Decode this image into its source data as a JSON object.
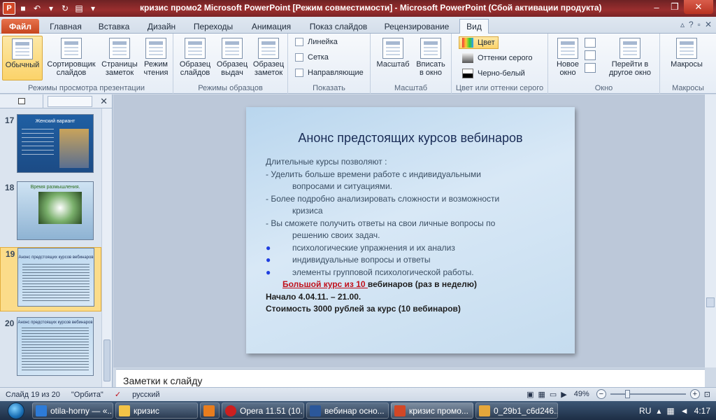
{
  "window": {
    "title": "кризис промо2 Microsoft PowerPoint [Режим совместимости]  -  Microsoft PowerPoint (Сбой активации продукта)"
  },
  "tabs": [
    "Файл",
    "Главная",
    "Вставка",
    "Дизайн",
    "Переходы",
    "Анимация",
    "Показ слайдов",
    "Рецензирование",
    "Вид"
  ],
  "ribbon": {
    "groups": {
      "presentation_views": "Режимы просмотра презентации",
      "master_views": "Режимы образцов",
      "show": "Показать",
      "zoom": "Масштаб",
      "color": "Цвет или оттенки серого",
      "window": "Окно",
      "macros": "Макросы"
    },
    "buttons": {
      "normal": "Обычный",
      "sorter_1": "Сортировщик",
      "sorter_2": "слайдов",
      "notes_1": "Страницы",
      "notes_2": "заметок",
      "reading_1": "Режим",
      "reading_2": "чтения",
      "slide_master_1": "Образец",
      "slide_master_2": "слайдов",
      "handout_master_1": "Образец",
      "handout_master_2": "выдач",
      "notes_master_1": "Образец",
      "notes_master_2": "заметок",
      "zoom": "Масштаб",
      "fit_1": "Вписать",
      "fit_2": "в окно",
      "new_window_1": "Новое",
      "new_window_2": "окно",
      "switch_1": "Перейти в",
      "switch_2": "другое окно",
      "macros": "Макросы"
    },
    "show": {
      "ruler": "Линейка",
      "grid": "Сетка",
      "guides": "Направляющие"
    },
    "color": {
      "color": "Цвет",
      "grayscale": "Оттенки серого",
      "bw": "Черно-белый"
    }
  },
  "slides_panel": {
    "items": [
      {
        "num": "17",
        "title": "Женский вариант"
      },
      {
        "num": "18",
        "title": "Время размышления."
      },
      {
        "num": "19",
        "title": "Анонс предстоящих курсов вебинаров"
      },
      {
        "num": "20",
        "title": "Анонс предстоящих курсов вебинаров"
      }
    ]
  },
  "slide": {
    "title": "Анонс предстоящих  курсов вебинаров",
    "intro": "Длительные  курсы позволяют :",
    "p1a": " - Уделить больше времени   работе   с индивидуальными",
    "p1b": "вопросами и ситуациями.",
    "p2a": "- Более подробно анализировать   сложности и возможности",
    "p2b": "кризиса",
    "p3a": "- Вы сможете получить ответы  на свои личные  вопросы по",
    "p3b": "решению  своих задач.",
    "b1": "психологические  упражнения и их анализ",
    "b2": "индивидуальные вопросы  и ответы",
    "b3": "элементы   групповой психологической работы.",
    "big_red": "Большой курс из 10 ",
    "big_rest": "вебинаров (раз в неделю)",
    "start": "Начало 4.04.11. – 21.00.",
    "price": "Стоимость  3000 рублей за курс (10 вебинаров)"
  },
  "notes": {
    "placeholder": "Заметки к слайду"
  },
  "status": {
    "slide_info": "Слайд 19 из 20",
    "theme": "\"Орбита\"",
    "language": "русский",
    "zoom": "49%",
    "zoom_fraction": 0.49
  },
  "taskbar": {
    "items": [
      "otila-horny — «...",
      "кризис",
      "",
      "Opera 11.51 (10...",
      "вебинар осно...",
      "кризис промо...",
      "0_29b1_c6d246..."
    ],
    "lang": "RU",
    "time": "4:17"
  },
  "colors": {
    "accent_file": "#d24726",
    "slide_title": "#1a2c56",
    "bullet": "#1f3ee0",
    "red_text": "#c0101b"
  }
}
